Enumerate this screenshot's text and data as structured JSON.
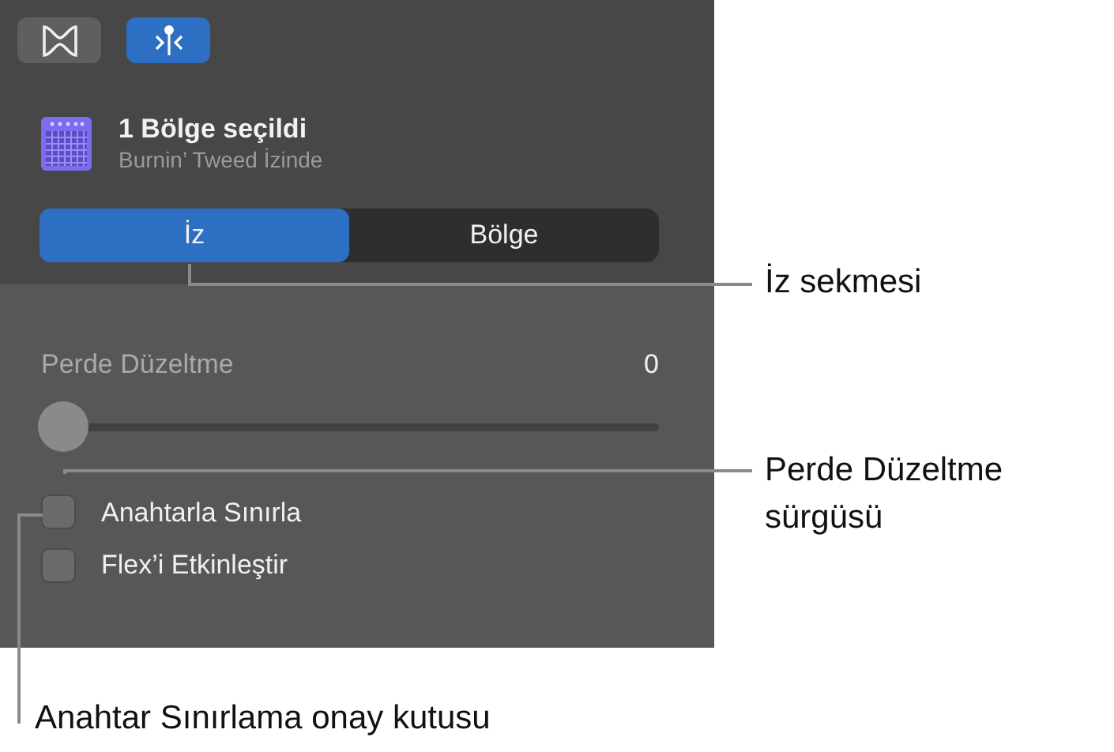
{
  "toolbar_buttons": [
    {
      "kind": "compare",
      "selected": false
    },
    {
      "kind": "tuner",
      "selected": true
    }
  ],
  "header": {
    "title": "1 Bölge seçildi",
    "subtitle": "Burnin’ Tweed İzinde"
  },
  "tabs": [
    {
      "label": "İz",
      "selected": true
    },
    {
      "label": "Bölge",
      "selected": false
    }
  ],
  "slider": {
    "label": "Perde Düzeltme",
    "reading": "0",
    "level": 0
  },
  "checkboxes": [
    {
      "label": "Anahtarla Sınırla",
      "checked": false
    },
    {
      "label": "Flex’i Etkinleştir",
      "checked": false
    }
  ],
  "callouts": [
    {
      "text": "İz sekmesi"
    },
    {
      "text": "Perde Düzeltme sürgüsü"
    },
    {
      "text": "Anahtar Sınırlama onay kutusu"
    }
  ]
}
